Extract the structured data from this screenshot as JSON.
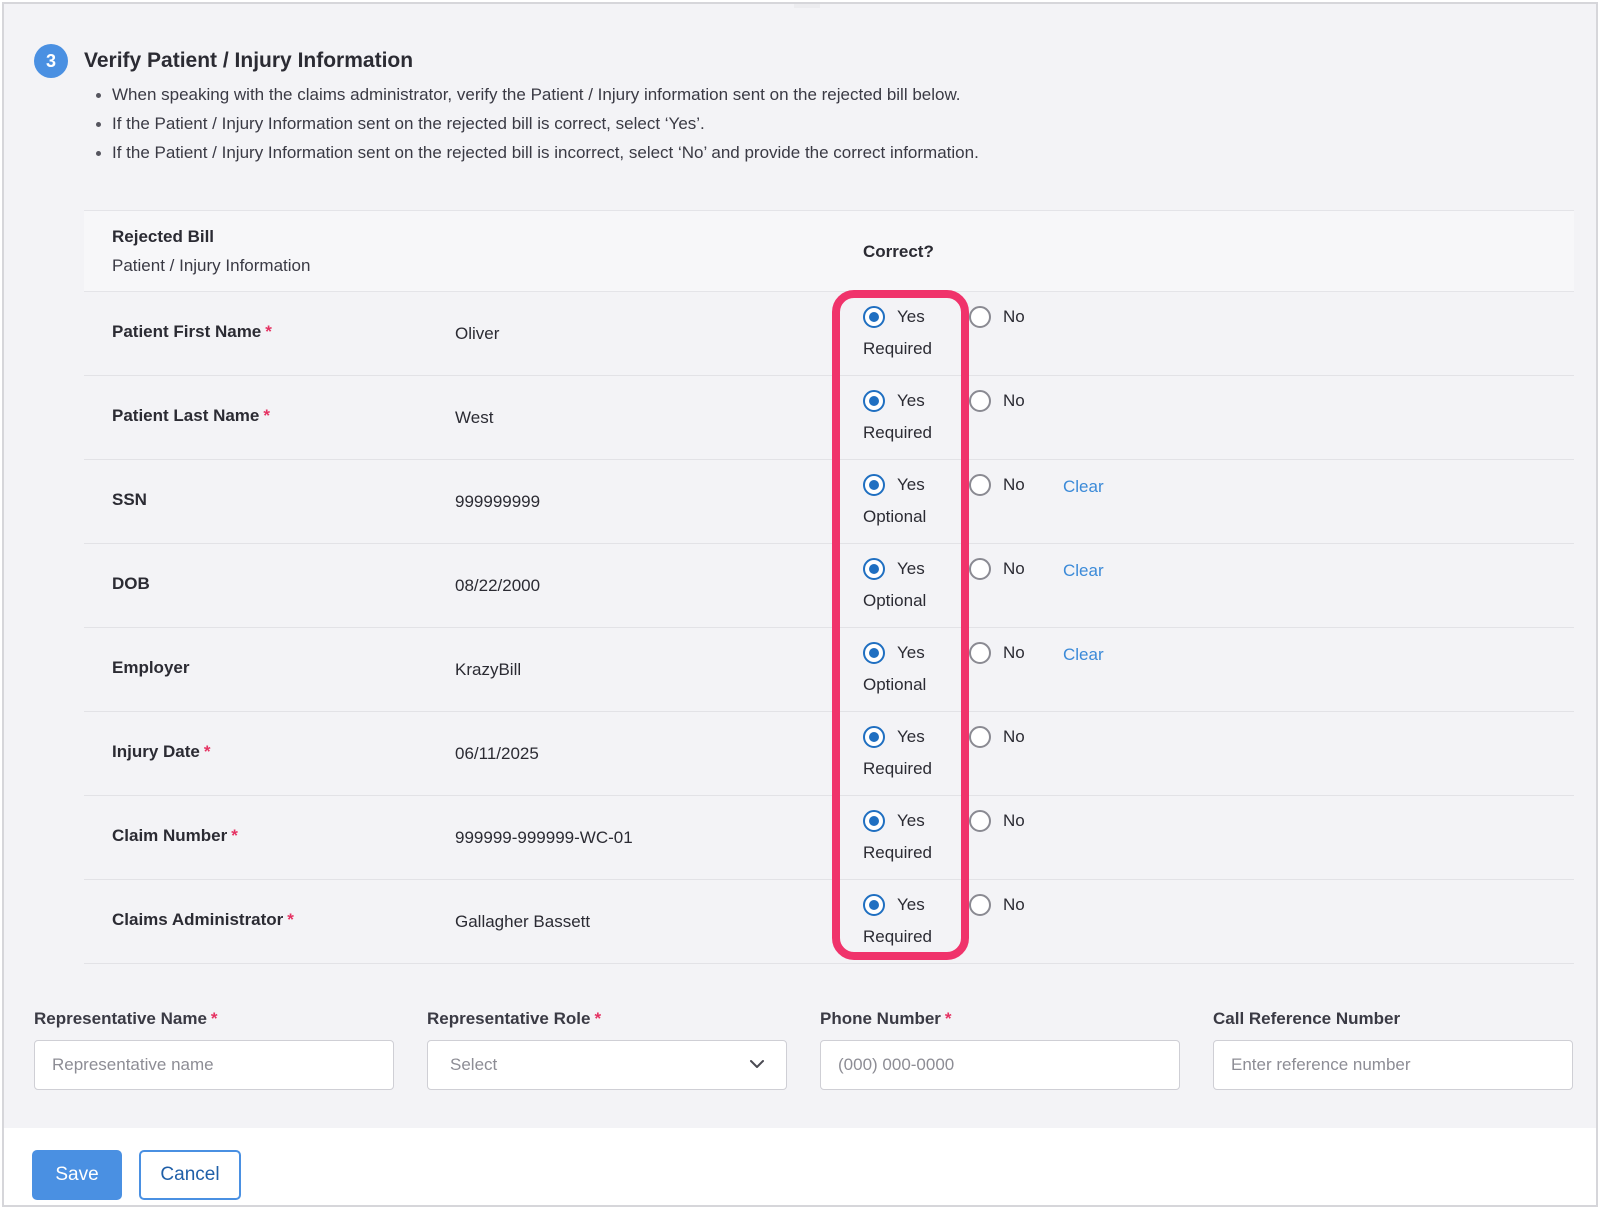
{
  "section": {
    "step_number": "3",
    "title": "Verify Patient / Injury Information",
    "instructions": [
      "When speaking with the claims administrator, verify the Patient / Injury information sent on the rejected bill below.",
      "If the Patient / Injury Information sent on the rejected bill is correct, select ‘Yes’.",
      "If the Patient / Injury Information sent on the rejected bill is incorrect, select ‘No’ and provide the correct information."
    ]
  },
  "table": {
    "header_label": "Rejected Bill",
    "header_sublabel": "Patient / Injury Information",
    "header_correct": "Correct?",
    "yes_label": "Yes",
    "no_label": "No",
    "clear_label": "Clear",
    "required_marker": "*",
    "rows": [
      {
        "label": "Patient First Name",
        "value": "Oliver",
        "hint": "Required",
        "selected": "Yes"
      },
      {
        "label": "Patient Last Name",
        "value": "West",
        "hint": "Required",
        "selected": "Yes"
      },
      {
        "label": "SSN",
        "value": "999999999",
        "hint": "Optional",
        "selected": "Yes"
      },
      {
        "label": "DOB",
        "value": "08/22/2000",
        "hint": "Optional",
        "selected": "Yes"
      },
      {
        "label": "Employer",
        "value": "KrazyBill",
        "hint": "Optional",
        "selected": "Yes"
      },
      {
        "label": "Injury Date",
        "value": "06/11/2025",
        "hint": "Required",
        "selected": "Yes"
      },
      {
        "label": "Claim Number",
        "value": "999999-999999-WC-01",
        "hint": "Required",
        "selected": "Yes"
      },
      {
        "label": "Claims Administrator",
        "value": "Gallagher Bassett",
        "hint": "Required",
        "selected": "Yes"
      }
    ]
  },
  "form": {
    "rep_name": {
      "label": "Representative Name",
      "placeholder": "Representative name",
      "value": ""
    },
    "rep_role": {
      "label": "Representative Role",
      "selected": "Select"
    },
    "phone": {
      "label": "Phone Number",
      "placeholder": "(000) 000-0000",
      "value": ""
    },
    "call_ref": {
      "label": "Call Reference Number",
      "placeholder": "Enter reference number",
      "value": ""
    }
  },
  "footer": {
    "save_label": "Save",
    "cancel_label": "Cancel"
  },
  "colors": {
    "accent": "#4a90e2",
    "radio_selected": "#1f6fc1",
    "required": "#e53262",
    "highlight": "#f0336b",
    "link": "#3b8ad8"
  }
}
